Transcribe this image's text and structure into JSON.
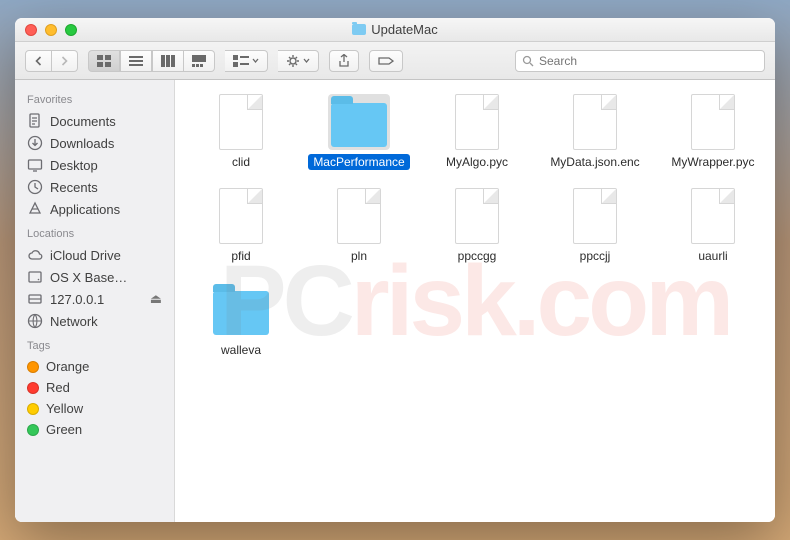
{
  "window": {
    "title": "UpdateMac"
  },
  "toolbar": {
    "search_placeholder": "Search"
  },
  "sidebar": {
    "sections": [
      {
        "title": "Favorites",
        "items": [
          {
            "label": "Documents",
            "icon": "documents"
          },
          {
            "label": "Downloads",
            "icon": "downloads"
          },
          {
            "label": "Desktop",
            "icon": "desktop"
          },
          {
            "label": "Recents",
            "icon": "recents"
          },
          {
            "label": "Applications",
            "icon": "applications"
          }
        ]
      },
      {
        "title": "Locations",
        "items": [
          {
            "label": "iCloud Drive",
            "icon": "icloud"
          },
          {
            "label": "OS X Base…",
            "icon": "disk"
          },
          {
            "label": "127.0.0.1",
            "icon": "server",
            "eject": true
          },
          {
            "label": "Network",
            "icon": "network"
          }
        ]
      },
      {
        "title": "Tags",
        "items": [
          {
            "label": "Orange",
            "tag": "tag-orange"
          },
          {
            "label": "Red",
            "tag": "tag-red"
          },
          {
            "label": "Yellow",
            "tag": "tag-yellow"
          },
          {
            "label": "Green",
            "tag": "tag-green"
          }
        ]
      }
    ]
  },
  "files": [
    {
      "name": "clid",
      "type": "file",
      "selected": false
    },
    {
      "name": "MacPerformance",
      "type": "folder",
      "selected": true
    },
    {
      "name": "MyAlgo.pyc",
      "type": "file",
      "selected": false
    },
    {
      "name": "MyData.json.enc",
      "type": "file",
      "selected": false
    },
    {
      "name": "MyWrapper.pyc",
      "type": "file",
      "selected": false
    },
    {
      "name": "pfid",
      "type": "file",
      "selected": false
    },
    {
      "name": "pln",
      "type": "file",
      "selected": false
    },
    {
      "name": "ppccgg",
      "type": "file",
      "selected": false
    },
    {
      "name": "ppccjj",
      "type": "file",
      "selected": false
    },
    {
      "name": "uaurli",
      "type": "file",
      "selected": false
    },
    {
      "name": "walleva",
      "type": "folder",
      "selected": false
    }
  ],
  "watermark": {
    "prefix": "PC",
    "suffix": "risk.com"
  }
}
